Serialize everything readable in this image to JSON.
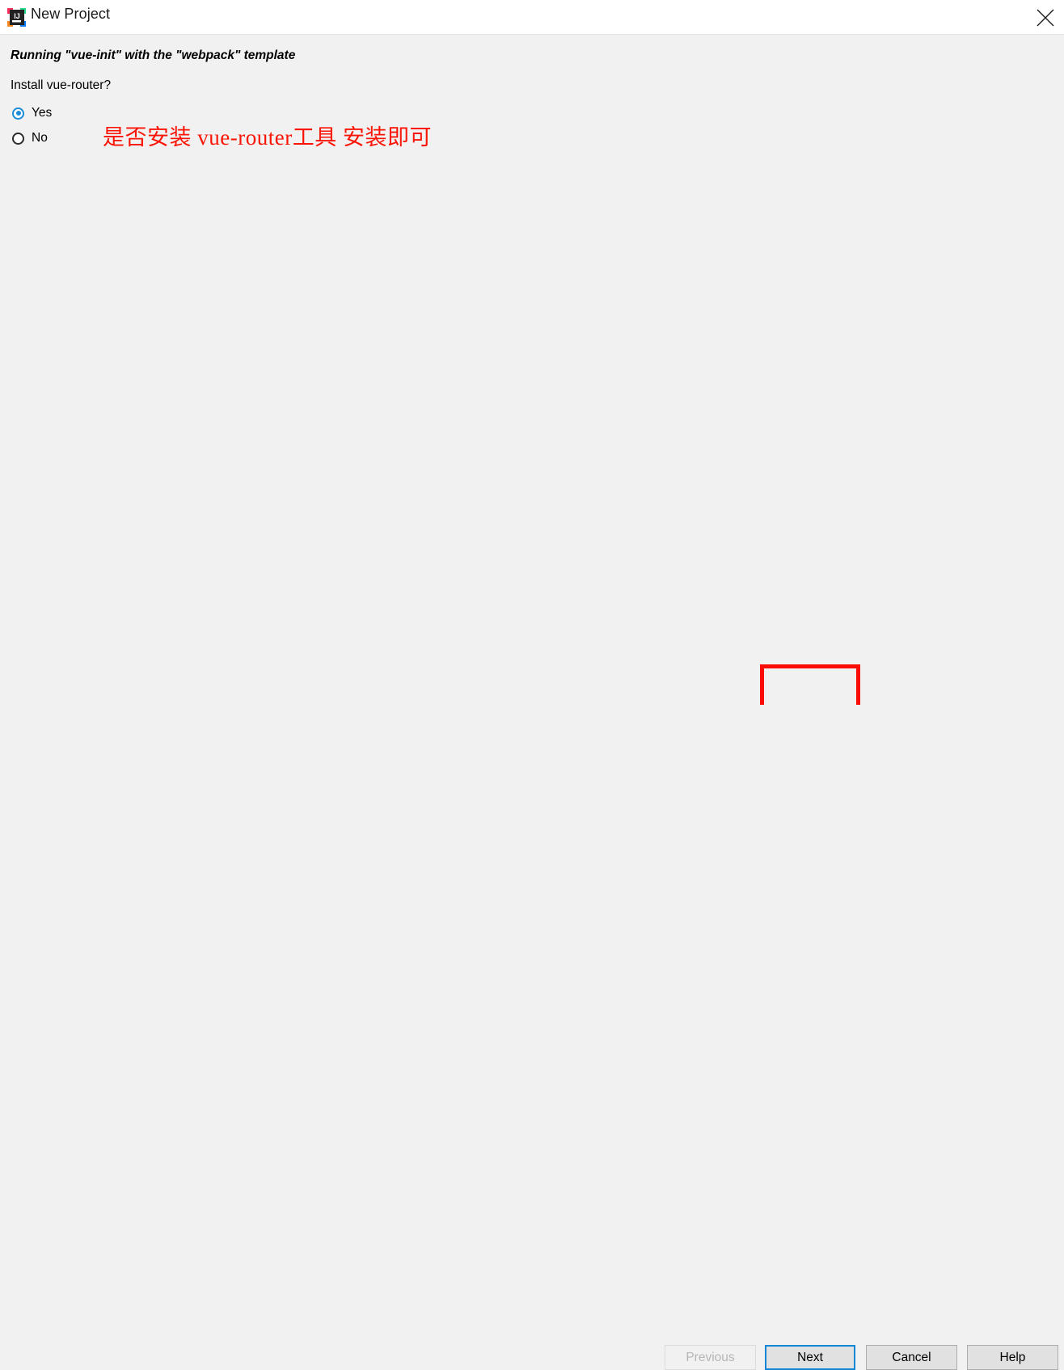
{
  "window": {
    "title": "New Project",
    "app_icon": "intellij-idea-icon",
    "close_icon": "close-icon",
    "titlebar_bg": "#ffffff",
    "body_bg": "#f1f1f1"
  },
  "content": {
    "running_line": "Running \"vue-init\" with the \"webpack\" template",
    "question": "Install vue-router?",
    "options": [
      {
        "label": "Yes",
        "selected": true
      },
      {
        "label": "No",
        "selected": false
      }
    ],
    "selected_option": "Yes",
    "accent_color": "#1a8cd8"
  },
  "annotations": {
    "text": "是否安装 vue-router工具 安装即可",
    "text_color": "#fa1405",
    "box_color": "#fb0d06",
    "box_target": "Next"
  },
  "buttons": {
    "previous": {
      "label": "Previous",
      "enabled": false
    },
    "next": {
      "label": "Next",
      "enabled": true,
      "focused": true,
      "focus_color": "#0d86d8"
    },
    "cancel": {
      "label": "Cancel",
      "enabled": true
    },
    "help": {
      "label": "Help",
      "enabled": true
    }
  }
}
